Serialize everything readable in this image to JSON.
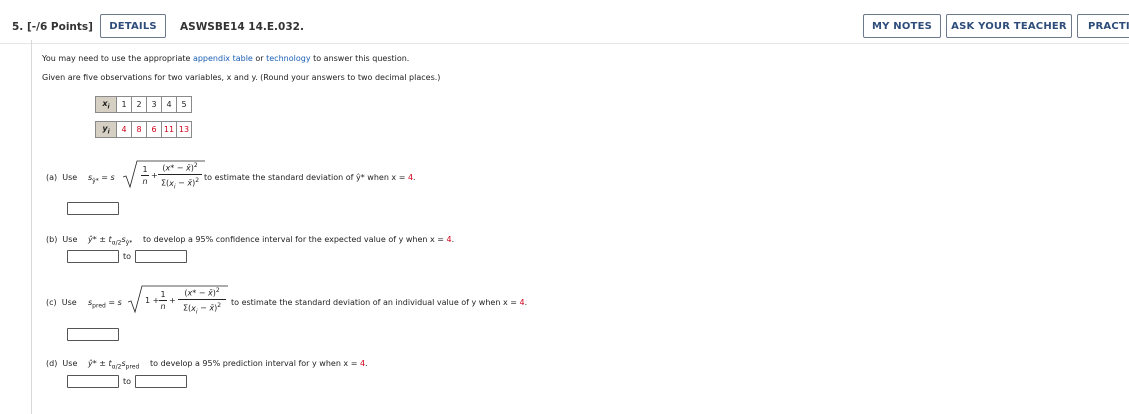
{
  "header": {
    "question_number": "5. [-/6 Points]",
    "details_label": "DETAILS",
    "question_code": "ASWSBE14 14.E.032.",
    "my_notes_label": "MY NOTES",
    "ask_teacher_label": "ASK YOUR TEACHER",
    "practice_label": "PRACTIC"
  },
  "intro": {
    "line1_prefix": "You may need to use the appropriate ",
    "line1_link1": "appendix table",
    "line1_mid": " or ",
    "line1_link2": "technology",
    "line1_suffix": " to answer this question.",
    "line2": "Given are five observations for two variables, x and y. (Round your answers to two decimal places.)"
  },
  "table": {
    "x_label": "xi",
    "y_label": "yi",
    "x_values": [
      "1",
      "2",
      "3",
      "4",
      "5"
    ],
    "y_values": [
      "4",
      "8",
      "6",
      "11",
      "13"
    ]
  },
  "parts": {
    "a": {
      "label": "(a)",
      "use": "Use",
      "text": "to estimate the standard deviation of ŷ* when x = ",
      "x_value": "4",
      "period": "."
    },
    "b": {
      "label": "(b)",
      "use": "Use",
      "text": "to develop a 95% confidence interval for the expected value of y when x = ",
      "x_value": "4",
      "period": ".",
      "to_label": "to"
    },
    "c": {
      "label": "(c)",
      "use": "Use",
      "text": "to estimate the standard deviation of an individual value of y when x = ",
      "x_value": "4",
      "period": "."
    },
    "d": {
      "label": "(d)",
      "use": "Use",
      "text": "to develop a 95% prediction interval for y when x = ",
      "x_value": "4",
      "period": ".",
      "to_label": "to"
    }
  },
  "colors": {
    "button_text": "#2e4d7a",
    "link": "#1a5fb4",
    "red_value": "#d0021b",
    "table_header_bg": "#d5cfc4"
  }
}
